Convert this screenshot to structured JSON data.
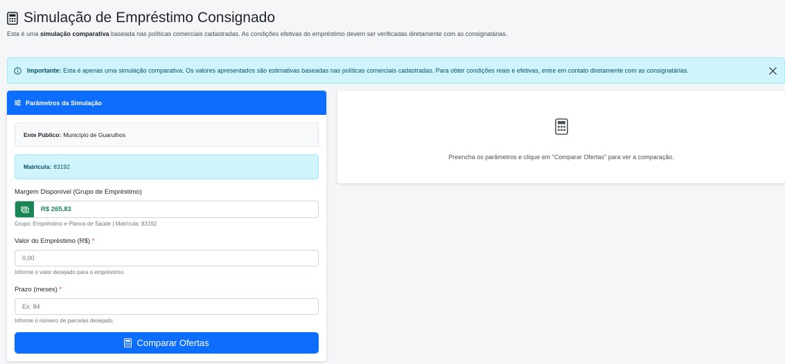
{
  "header": {
    "title": "Simulação de Empréstimo Consignado",
    "subtitle_pre": "Esta é uma ",
    "subtitle_bold": "simulação comparativa",
    "subtitle_post": " baseada nas políticas comerciais cadastradas. As condições efetivas do empréstimo devem ser verificadas diretamente com as consignatárias."
  },
  "alert": {
    "bold": "Importante:",
    "text": " Esta é apenas uma simulação comparativa. Os valores apresentados são estimativas baseadas nas políticas comerciais cadastradas. Para obter condições reais e efetivas, entre em contato diretamente com as consignatárias."
  },
  "params": {
    "header": "Parâmetros da Simulação",
    "ente_label": "Ente Público:",
    "ente_value": "Município de Guarulhos",
    "matricula_label": "Matrícula:",
    "matricula_value": "83192",
    "margin_label": "Margem Disponível (Grupo de Empréstimo)",
    "margin_value": "R$ 265,83",
    "margin_help": "Grupo: Empréstimo e Planos de Saúde | Matrícula: 83192",
    "valor_label": "Valor do Empréstimo (R$)",
    "valor_placeholder": "0,00",
    "valor_help": "Informe o valor desejado para o empréstimo.",
    "prazo_label": "Prazo (meses)",
    "prazo_placeholder": "Ex: 84",
    "prazo_help": "Informe o número de parcelas desejado.",
    "required_mark": "*",
    "compare_button": "Comparar Ofertas"
  },
  "result": {
    "hint": "Preencha os parâmetros e clique em \"Comparar Ofertas\" para ver a comparação."
  },
  "icons": {
    "title": "calculator-icon",
    "alert": "info-circle-icon",
    "close": "close-icon",
    "params_header": "sliders-icon",
    "margin": "cash-icon",
    "button": "calculator-icon",
    "result": "calculator-icon"
  },
  "colors": {
    "primary": "#0d6efd",
    "success": "#198754",
    "info_bg": "#cff4fc",
    "danger": "#dc3545"
  }
}
